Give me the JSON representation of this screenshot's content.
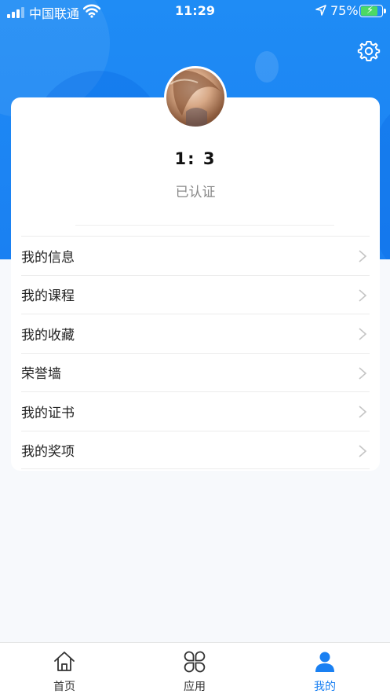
{
  "status_bar": {
    "carrier": "中国联通",
    "time": "11:29",
    "battery": "75%"
  },
  "profile": {
    "username": "1:                  3",
    "status": "已认证"
  },
  "menu": {
    "items": [
      {
        "label": "我的信息"
      },
      {
        "label": "我的课程"
      },
      {
        "label": "我的收藏"
      },
      {
        "label": "荣誉墙"
      },
      {
        "label": "我的证书"
      },
      {
        "label": "我的奖项"
      }
    ]
  },
  "tabbar": {
    "tabs": [
      {
        "label": "首页",
        "icon": "home-icon"
      },
      {
        "label": "应用",
        "icon": "apps-icon"
      },
      {
        "label": "我的",
        "icon": "profile-icon",
        "active": true
      }
    ]
  },
  "colors": {
    "accent": "#1a80f2",
    "battery_fill": "#4cd964"
  }
}
